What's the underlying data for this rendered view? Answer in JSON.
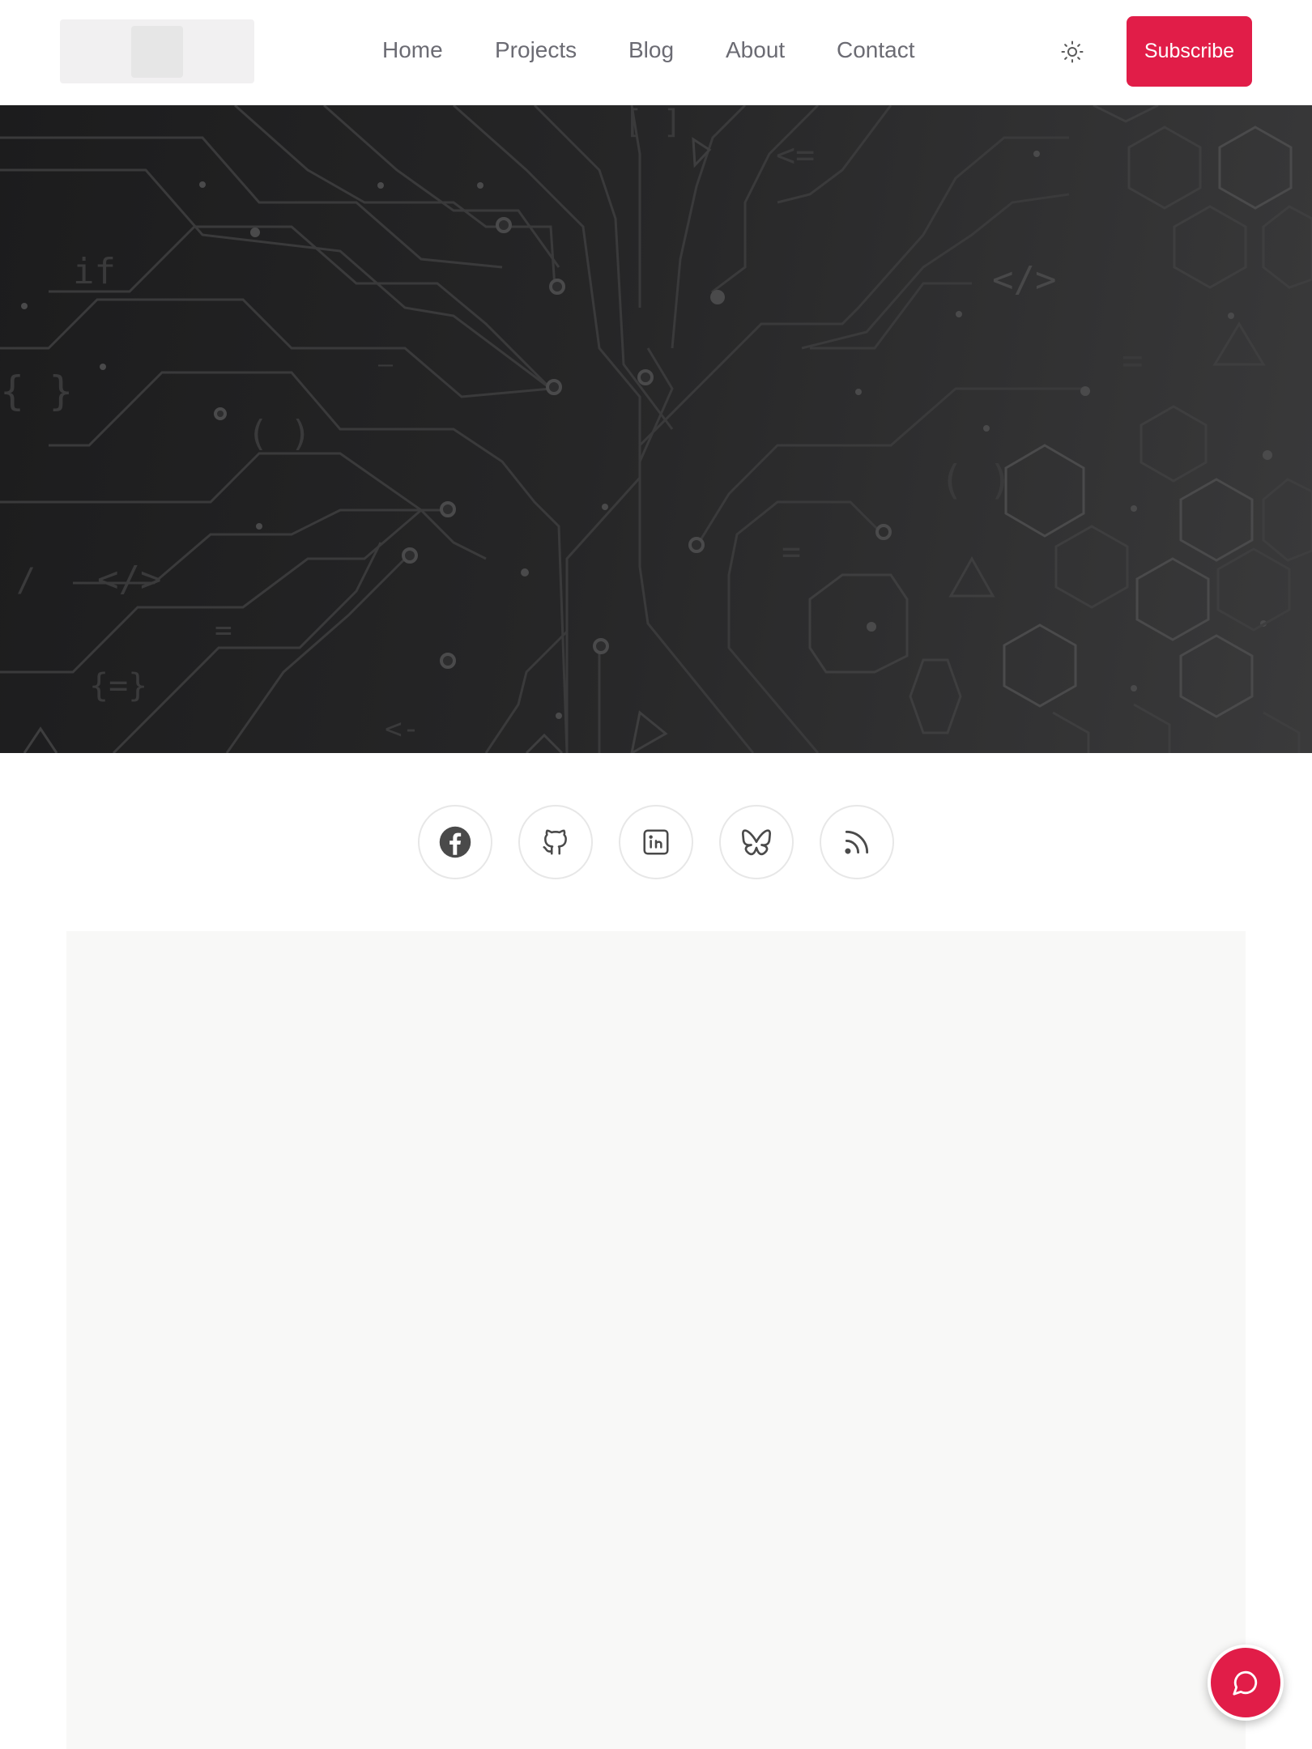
{
  "header": {
    "logo_alt": "",
    "nav": [
      {
        "label": "Home"
      },
      {
        "label": "Projects"
      },
      {
        "label": "Blog"
      },
      {
        "label": "About"
      },
      {
        "label": "Contact"
      }
    ],
    "theme_toggle_icon": "sun-icon",
    "subscribe_label": "Subscribe"
  },
  "hero": {
    "background": "dark circuit-board pattern",
    "code_glyphs": [
      "if",
      "{ }",
      "( )",
      "</>",
      "</>",
      "( )",
      "[ ]",
      "=",
      "<=",
      "<-"
    ]
  },
  "social": [
    {
      "icon": "facebook-icon"
    },
    {
      "icon": "github-icon"
    },
    {
      "icon": "linkedin-icon"
    },
    {
      "icon": "bluesky-icon"
    },
    {
      "icon": "rss-icon"
    }
  ],
  "chat": {
    "icon": "chat-icon"
  },
  "colors": {
    "accent": "#e11d48",
    "nav_text": "#6b6b73",
    "hero_dark": "#1c1c1d",
    "hero_light": "#3a3a3b",
    "icon": "#4a4a4a"
  }
}
